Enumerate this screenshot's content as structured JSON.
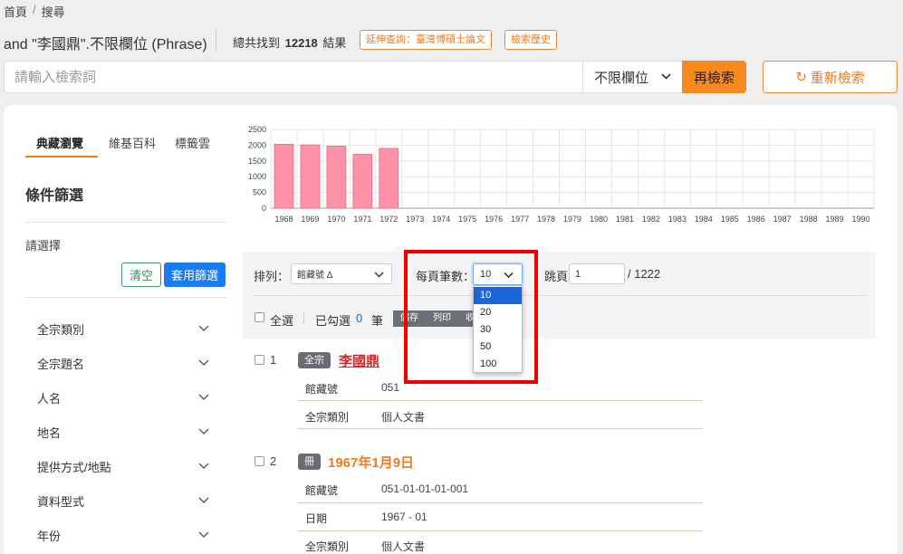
{
  "breadcrumb": {
    "home": "首頁",
    "sep": "/",
    "current": "搜尋"
  },
  "header": {
    "query": "and \"李國鼎\".不限欄位 (Phrase)",
    "count_prefix": "總共找到",
    "count": "12218",
    "count_suffix": "結果",
    "extend_btn": "延伸查詢：臺灣博碩士論文",
    "history_btn": "檢索歷史"
  },
  "search": {
    "placeholder": "請輸入檢索詞",
    "field": "不限欄位",
    "search_btn": "再檢索",
    "reset_btn": "重新檢索",
    "reset_icon": "↻"
  },
  "sidebar": {
    "tabs": [
      "典藏瀏覽",
      "維基百科",
      "標籤雲"
    ],
    "filter_title": "條件篩選",
    "please_select": "請選擇",
    "clear_btn": "清空",
    "apply_btn": "套用篩選",
    "facets": [
      "全宗類別",
      "全宗題名",
      "人名",
      "地名",
      "提供方式/地點",
      "資料型式",
      "年份"
    ]
  },
  "chart_data": {
    "type": "bar",
    "categories": [
      "1968",
      "1969",
      "1970",
      "1971",
      "1972",
      "1973",
      "1974",
      "1975",
      "1976",
      "1977",
      "1978",
      "1979",
      "1980",
      "1981",
      "1982",
      "1983",
      "1984",
      "1985",
      "1986",
      "1987",
      "1988",
      "1989",
      "1990"
    ],
    "values": [
      2030,
      2010,
      1970,
      1710,
      1900,
      0,
      0,
      0,
      0,
      0,
      0,
      0,
      0,
      0,
      0,
      0,
      0,
      0,
      0,
      0,
      0,
      0,
      0
    ],
    "yticks": [
      0,
      500,
      1000,
      1500,
      2000,
      2500
    ],
    "ylim": [
      0,
      2500
    ],
    "grid": true,
    "bar_color": "#ff91a8",
    "bar_edge": "#e86a88"
  },
  "controls": {
    "sort_label": "排列：",
    "sort_value": "館藏號 Δ",
    "perpage_label": "每頁筆數：",
    "perpage_value": "10",
    "perpage_options": [
      "10",
      "20",
      "30",
      "50",
      "100"
    ],
    "jump_label": "跳頁",
    "jump_value": "1",
    "total_pages": "/ 1222",
    "select_all": "全選",
    "selected_label": "已勾選",
    "selected_count": "0",
    "selected_unit": "筆",
    "save_btn": "儲存",
    "print_btn": "列印",
    "collect_btn": "收藏"
  },
  "results": [
    {
      "num": "1",
      "badge": "全宗",
      "title": "李國鼎",
      "fields": [
        {
          "key": "館藏號",
          "value": "051"
        },
        {
          "key": "全宗類別",
          "value": "個人文書"
        }
      ]
    },
    {
      "num": "2",
      "badge": "冊",
      "title": "1967年1月9日",
      "fields": [
        {
          "key": "館藏號",
          "value": "051-01-01-01-001"
        },
        {
          "key": "日期",
          "value": "1967 - 01"
        },
        {
          "key": "全宗類別",
          "value": "個人文書"
        }
      ]
    }
  ],
  "colors": {
    "accent": "#f07a20",
    "primary": "#1a7cf0",
    "highlight": "#e00000"
  }
}
